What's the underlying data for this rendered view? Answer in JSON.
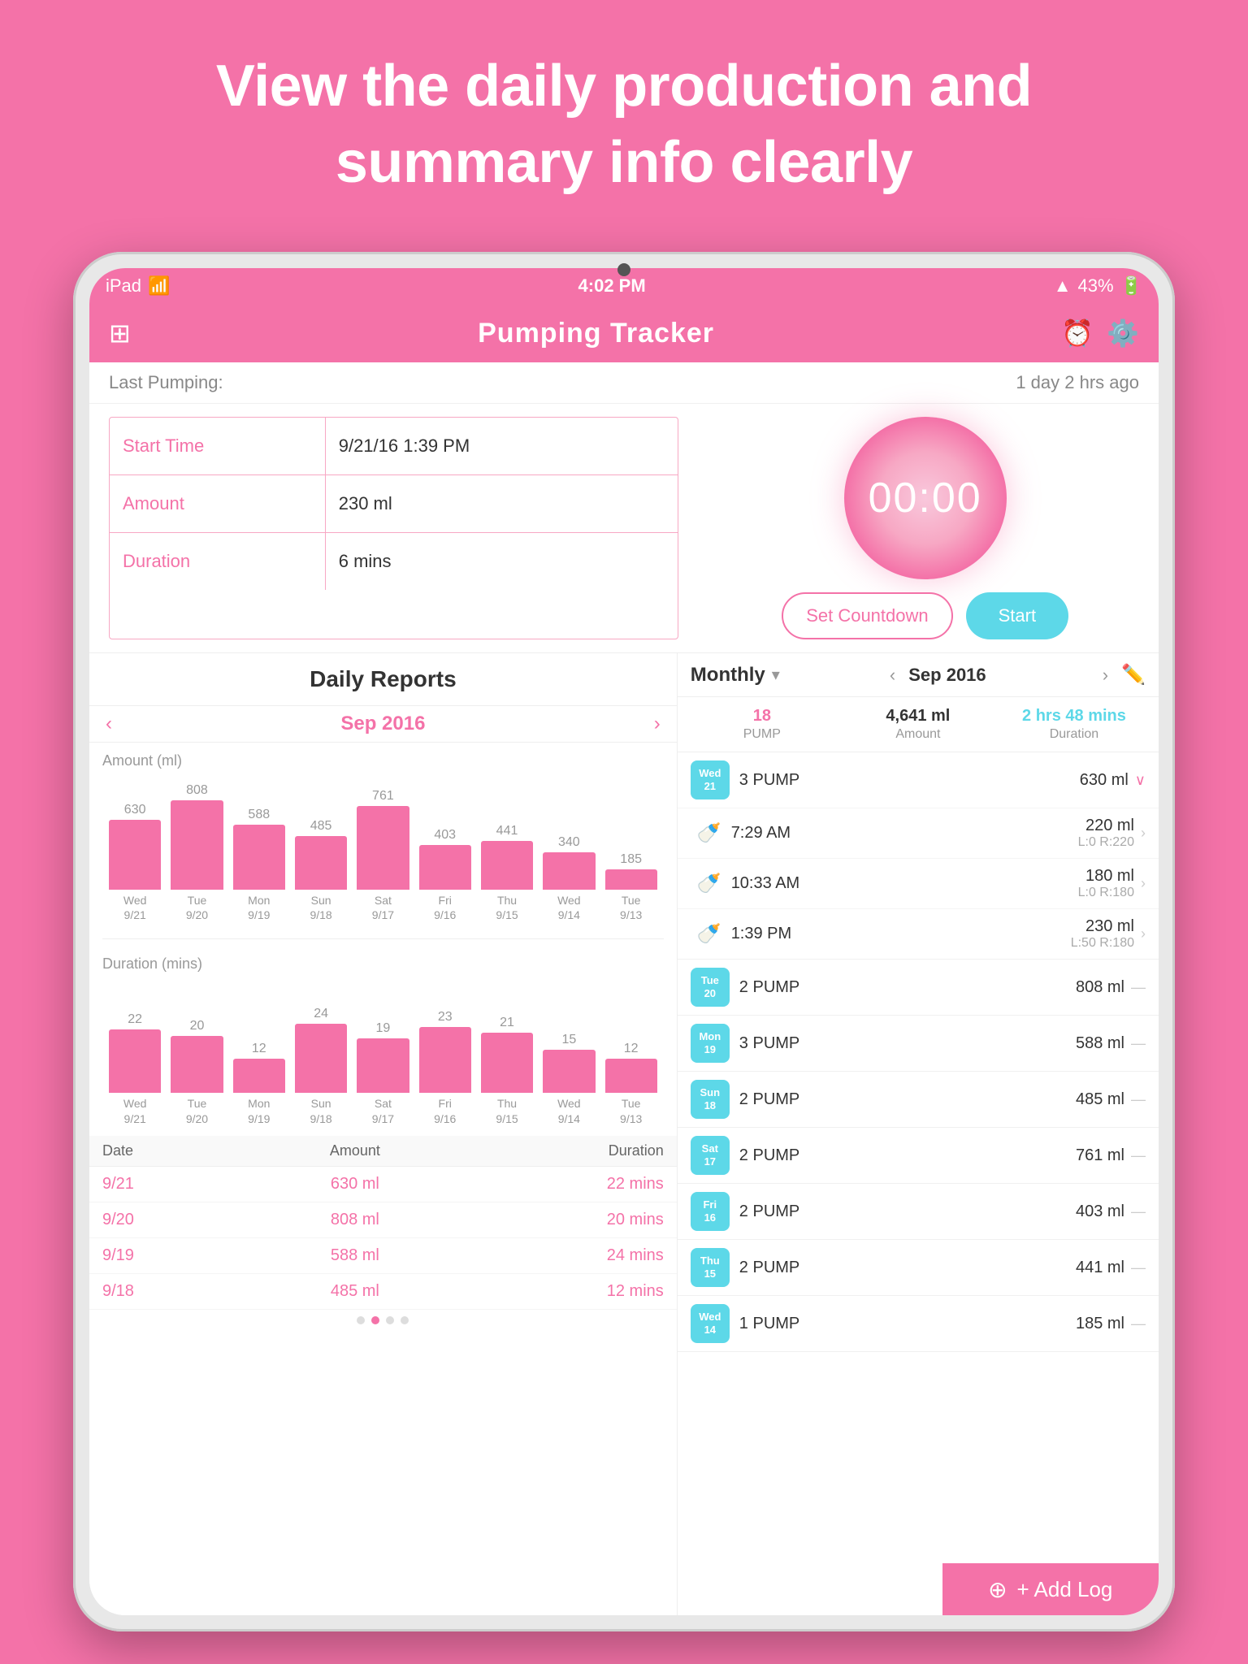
{
  "background": {
    "title_line1": "View the daily production and",
    "title_line2": "summary info clearly",
    "color": "#F472A8"
  },
  "status_bar": {
    "device": "iPad",
    "wifi": "wifi",
    "time": "4:02 PM",
    "signal": "signal",
    "battery": "43%"
  },
  "app_header": {
    "title": "Pumping Tracker",
    "left_icon": "grid-icon",
    "right_icon_1": "clock-icon",
    "right_icon_2": "settings-icon"
  },
  "last_pumping": {
    "label": "Last Pumping:",
    "time": "1 day 2 hrs ago"
  },
  "info_table": {
    "rows": [
      {
        "label": "Start Time",
        "value": "9/21/16 1:39 PM"
      },
      {
        "label": "Amount",
        "value": "230 ml"
      },
      {
        "label": "Duration",
        "value": "6 mins"
      }
    ]
  },
  "timer": {
    "display": "00:00",
    "set_countdown_label": "Set Countdown",
    "start_label": "Start"
  },
  "daily_reports": {
    "title": "Daily Reports",
    "month": "Sep 2016",
    "chart_amount_label": "Amount (ml)",
    "bars_amount": [
      {
        "label": "Wed\n9/21",
        "value": 630,
        "height_pct": 78
      },
      {
        "label": "Tue\n9/20",
        "value": 808,
        "height_pct": 100
      },
      {
        "label": "Mon\n9/19",
        "value": 588,
        "height_pct": 73
      },
      {
        "label": "Sun\n9/18",
        "value": 485,
        "height_pct": 60
      },
      {
        "label": "Sat\n9/17",
        "value": 761,
        "height_pct": 94
      },
      {
        "label": "Fri\n9/16",
        "value": 403,
        "height_pct": 50
      },
      {
        "label": "Thu\n9/15",
        "value": 441,
        "height_pct": 55
      },
      {
        "label": "Wed\n9/14",
        "value": 340,
        "height_pct": 42
      },
      {
        "label": "Tue\n9/13",
        "value": 185,
        "height_pct": 23
      }
    ],
    "chart_duration_label": "Duration (mins)",
    "bars_duration": [
      {
        "label": "Wed\n9/21",
        "value": 22,
        "height_pct": 92
      },
      {
        "label": "Tue\n9/20",
        "value": 20,
        "height_pct": 83
      },
      {
        "label": "Mon\n9/19",
        "value": 12,
        "height_pct": 50
      },
      {
        "label": "Sun\n9/18",
        "value": 24,
        "height_pct": 100
      },
      {
        "label": "Sat\n9/17",
        "value": 19,
        "height_pct": 79
      },
      {
        "label": "Fri\n9/16",
        "value": 23,
        "height_pct": 96
      },
      {
        "label": "Thu\n9/15",
        "value": 21,
        "height_pct": 88
      },
      {
        "label": "Wed\n9/14",
        "value": 15,
        "height_pct": 63
      },
      {
        "label": "Tue\n9/13",
        "value": 12,
        "height_pct": 50
      }
    ],
    "table_headers": [
      "Date",
      "Amount",
      "Duration"
    ],
    "table_rows": [
      {
        "date": "9/21",
        "amount": "630 ml",
        "duration": "22 mins"
      },
      {
        "date": "9/20",
        "amount": "808 ml",
        "duration": "20 mins"
      },
      {
        "date": "9/19",
        "amount": "588 ml",
        "duration": "24 mins"
      },
      {
        "date": "9/18",
        "amount": "485 ml",
        "duration": "12 mins"
      }
    ],
    "page_dots": [
      false,
      true,
      false,
      false
    ]
  },
  "monthly_panel": {
    "label": "Monthly",
    "month_year": "Sep 2016",
    "stats": {
      "pump_count": "18",
      "pump_label": "PUMP",
      "amount": "4,641 ml",
      "amount_label": "Amount",
      "duration": "2 hrs 48 mins",
      "duration_label": "Duration"
    },
    "days": [
      {
        "badge_day": "Wed",
        "badge_date": "21",
        "badge_color": "teal",
        "pump_count": "3 PUMP",
        "amount": "630 ml",
        "expanded": true,
        "entries": [
          {
            "icon": "🍼",
            "time": "7:29 AM",
            "amount": "220 ml",
            "detail": "L:0 R:220"
          },
          {
            "icon": "🍼",
            "time": "10:33 AM",
            "amount": "180 ml",
            "detail": "L:0 R:180"
          },
          {
            "icon": "🍼",
            "time": "1:39 PM",
            "amount": "230 ml",
            "detail": "L:50 R:180"
          }
        ]
      },
      {
        "badge_day": "Tue",
        "badge_date": "20",
        "badge_color": "teal",
        "pump_count": "2 PUMP",
        "amount": "808 ml",
        "expanded": false,
        "entries": []
      },
      {
        "badge_day": "Mon",
        "badge_date": "19",
        "badge_color": "teal",
        "pump_count": "3 PUMP",
        "amount": "588 ml",
        "expanded": false,
        "entries": []
      },
      {
        "badge_day": "Sun",
        "badge_date": "18",
        "badge_color": "teal",
        "pump_count": "2 PUMP",
        "amount": "485 ml",
        "expanded": false,
        "entries": []
      },
      {
        "badge_day": "Sat",
        "badge_date": "17",
        "badge_color": "teal",
        "pump_count": "2 PUMP",
        "amount": "761 ml",
        "expanded": false,
        "entries": []
      },
      {
        "badge_day": "Fri",
        "badge_date": "16",
        "badge_color": "teal",
        "pump_count": "2 PUMP",
        "amount": "403 ml",
        "expanded": false,
        "entries": []
      },
      {
        "badge_day": "Thu",
        "badge_date": "15",
        "badge_color": "teal",
        "pump_count": "2 PUMP",
        "amount": "441 ml",
        "expanded": false,
        "entries": []
      },
      {
        "badge_day": "Wed",
        "badge_date": "14",
        "badge_color": "teal",
        "pump_count": "1 PUMP",
        "amount": "185 ml",
        "expanded": false,
        "entries": []
      }
    ],
    "add_log_label": "+ Add Log"
  }
}
